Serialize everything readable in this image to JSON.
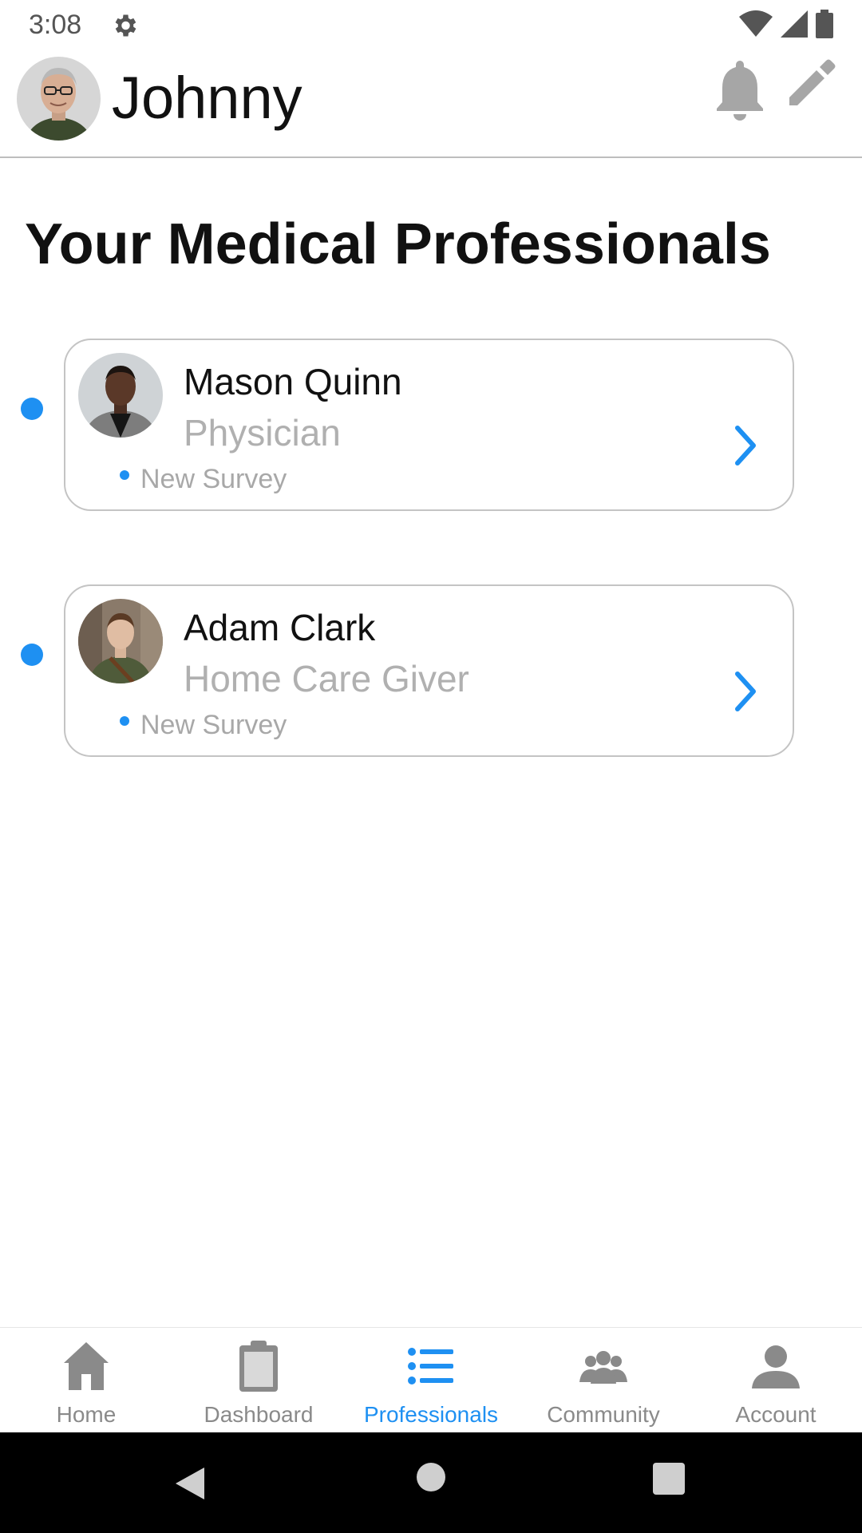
{
  "status_bar": {
    "time": "3:08",
    "icons": [
      "gear-icon",
      "wifi-icon",
      "signal-icon",
      "battery-icon"
    ]
  },
  "header": {
    "user_name": "Johnny",
    "actions": [
      "bell-icon",
      "pencil-icon"
    ]
  },
  "page": {
    "title": "Your Medical Professionals"
  },
  "professionals": [
    {
      "name": "Mason Quinn",
      "role": "Physician",
      "badge": "New Survey",
      "unread": true
    },
    {
      "name": "Adam Clark",
      "role": "Home Care Giver",
      "badge": "New Survey",
      "unread": true
    }
  ],
  "bottom_nav": {
    "items": [
      {
        "label": "Home",
        "icon": "home-icon",
        "active": false
      },
      {
        "label": "Dashboard",
        "icon": "clipboard-icon",
        "active": false
      },
      {
        "label": "Professionals",
        "icon": "list-icon",
        "active": true
      },
      {
        "label": "Community",
        "icon": "group-icon",
        "active": false
      },
      {
        "label": "Account",
        "icon": "person-icon",
        "active": false
      }
    ]
  },
  "colors": {
    "accent": "#1e90f2",
    "muted_text": "#b0b0b0",
    "icon_gray": "#9e9e9e",
    "border": "#c4c4c4"
  }
}
